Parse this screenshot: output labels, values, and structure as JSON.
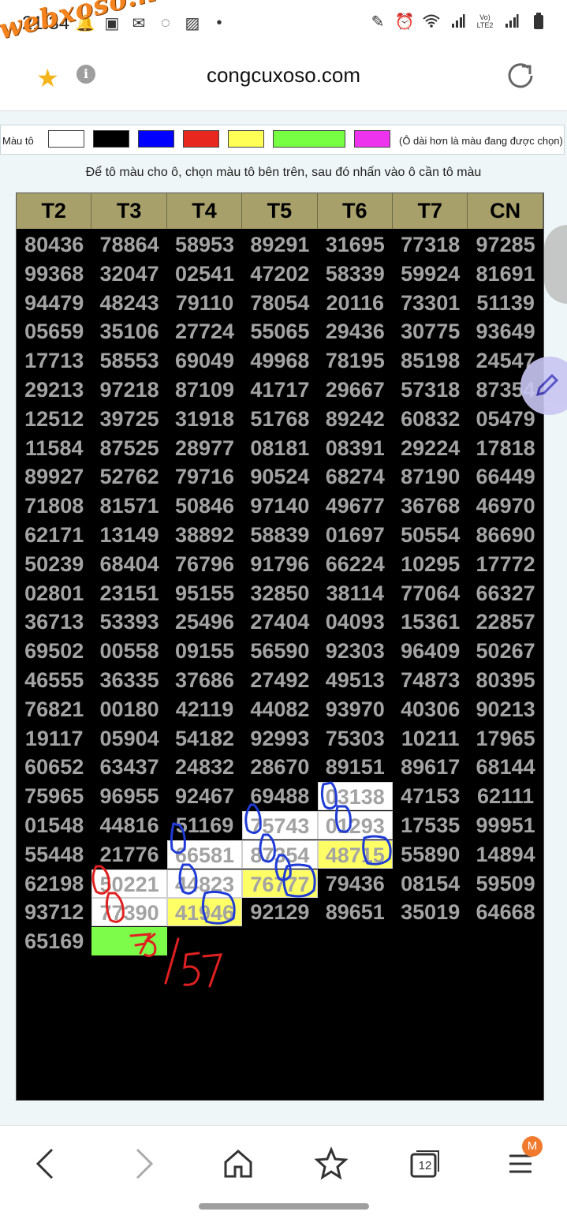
{
  "status_bar": {
    "time": "21:34",
    "network": "Vo) LTE2"
  },
  "watermark": "webxoso.net",
  "browser": {
    "domain": "congcuxoso.com",
    "tabs_count": "12",
    "profile_badge": "M"
  },
  "color_bar": {
    "label": "Màu tô",
    "swatches": [
      "#ffffff",
      "#000000",
      "#0000ff",
      "#e8281e",
      "#ffff55",
      "#77ff44",
      "#ee33ee"
    ],
    "note": "(Ô dài hơn là màu đang được chọn)"
  },
  "instruction": "Để tô màu cho ô, chọn màu tô bên trên, sau đó nhấn vào ô cần tô màu",
  "table": {
    "headers": [
      "T2",
      "T3",
      "T4",
      "T5",
      "T6",
      "T7",
      "CN"
    ],
    "rows": [
      [
        "80436",
        "78864",
        "58953",
        "89291",
        "31695",
        "77318",
        "97285"
      ],
      [
        "99368",
        "32047",
        "02541",
        "47202",
        "58339",
        "59924",
        "81691"
      ],
      [
        "94479",
        "48243",
        "79110",
        "78054",
        "20116",
        "73301",
        "51139"
      ],
      [
        "05659",
        "35106",
        "27724",
        "55065",
        "29436",
        "30775",
        "93649"
      ],
      [
        "17713",
        "58553",
        "69049",
        "49968",
        "78195",
        "85198",
        "24547"
      ],
      [
        "29213",
        "97218",
        "87109",
        "41717",
        "29667",
        "57318",
        "87354"
      ],
      [
        "12512",
        "39725",
        "31918",
        "51768",
        "89242",
        "60832",
        "05479"
      ],
      [
        "11584",
        "87525",
        "28977",
        "08181",
        "08391",
        "29224",
        "17818"
      ],
      [
        "89927",
        "52762",
        "79716",
        "90524",
        "68274",
        "87190",
        "66449"
      ],
      [
        "71808",
        "81571",
        "50846",
        "97140",
        "49677",
        "36768",
        "46970"
      ],
      [
        "62171",
        "13149",
        "38892",
        "58839",
        "01697",
        "50554",
        "86690"
      ],
      [
        "50239",
        "68404",
        "76796",
        "91796",
        "66224",
        "10295",
        "17772"
      ],
      [
        "02801",
        "23151",
        "95155",
        "32850",
        "38114",
        "77064",
        "66327"
      ],
      [
        "36713",
        "53393",
        "25496",
        "27404",
        "04093",
        "15361",
        "22857"
      ],
      [
        "69502",
        "00558",
        "09155",
        "56590",
        "92303",
        "96409",
        "50267"
      ],
      [
        "46555",
        "36335",
        "37686",
        "27492",
        "49513",
        "74873",
        "80395"
      ],
      [
        "76821",
        "00180",
        "42119",
        "44082",
        "93970",
        "40306",
        "90213"
      ],
      [
        "19117",
        "05904",
        "54182",
        "92993",
        "75303",
        "10211",
        "17965"
      ],
      [
        "60652",
        "63437",
        "24832",
        "28670",
        "89151",
        "89617",
        "68144"
      ],
      [
        "75965",
        "96955",
        "92467",
        "69488",
        "03138",
        "47153",
        "62111"
      ],
      [
        "01548",
        "44816",
        "51169",
        "75743",
        "01293",
        "17535",
        "99951"
      ],
      [
        "55448",
        "21776",
        "66581",
        "87354",
        "48715",
        "55890",
        "14894"
      ],
      [
        "62198",
        "50221",
        "44823",
        "76777",
        "79436",
        "08154",
        "59509"
      ],
      [
        "93712",
        "77390",
        "41946",
        "92129",
        "89651",
        "35019",
        "64668"
      ],
      [
        "65169",
        "",
        "",
        "",
        "",
        "",
        ""
      ]
    ],
    "highlights": [
      {
        "row": 19,
        "col": 4,
        "color": "white"
      },
      {
        "row": 20,
        "col": 3,
        "color": "white"
      },
      {
        "row": 20,
        "col": 4,
        "color": "white"
      },
      {
        "row": 21,
        "col": 2,
        "color": "white"
      },
      {
        "row": 21,
        "col": 3,
        "color": "white"
      },
      {
        "row": 21,
        "col": 4,
        "color": "yellow"
      },
      {
        "row": 22,
        "col": 1,
        "color": "white"
      },
      {
        "row": 22,
        "col": 2,
        "color": "white"
      },
      {
        "row": 22,
        "col": 3,
        "color": "yellow"
      },
      {
        "row": 23,
        "col": 1,
        "color": "white"
      },
      {
        "row": 23,
        "col": 2,
        "color": "yellow"
      },
      {
        "row": 24,
        "col": 1,
        "color": "green"
      }
    ]
  },
  "handwriting": "75/57"
}
